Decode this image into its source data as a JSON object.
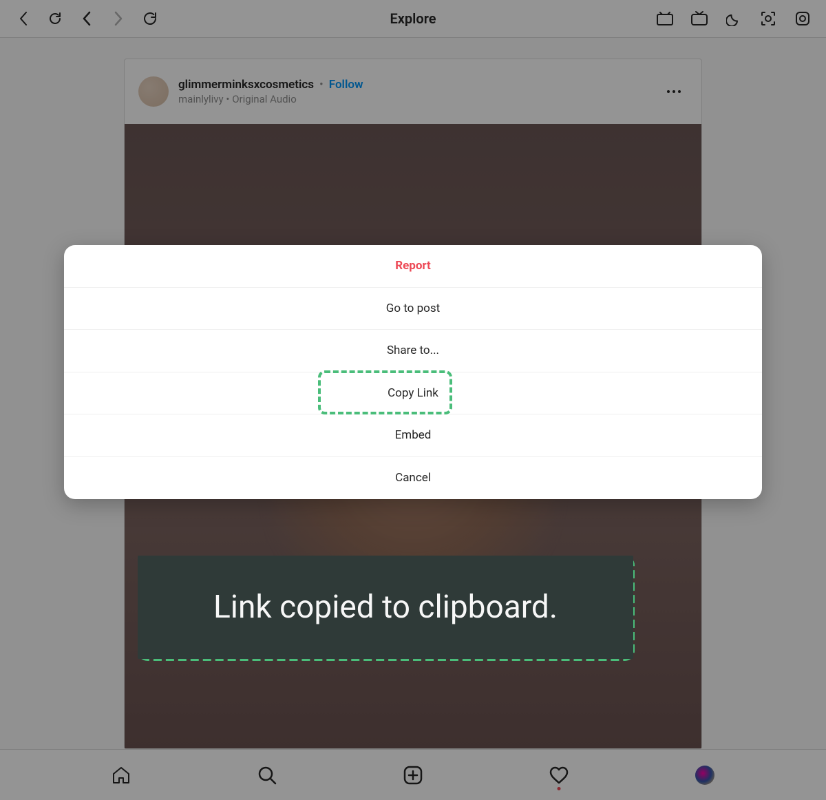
{
  "header": {
    "title": "Explore"
  },
  "post": {
    "username": "glimmerminksxcosmetics",
    "follow_label": "Follow",
    "audio_source": "mainlylivy",
    "audio_type": "Original Audio"
  },
  "action_sheet": {
    "report": "Report",
    "go_to_post": "Go to post",
    "share_to": "Share to...",
    "copy_link": "Copy Link",
    "embed": "Embed",
    "cancel": "Cancel"
  },
  "toast": {
    "message": "Link copied to clipboard."
  },
  "colors": {
    "accent": "#0095f6",
    "danger": "#ed4956",
    "highlight": "#4abd7a"
  }
}
